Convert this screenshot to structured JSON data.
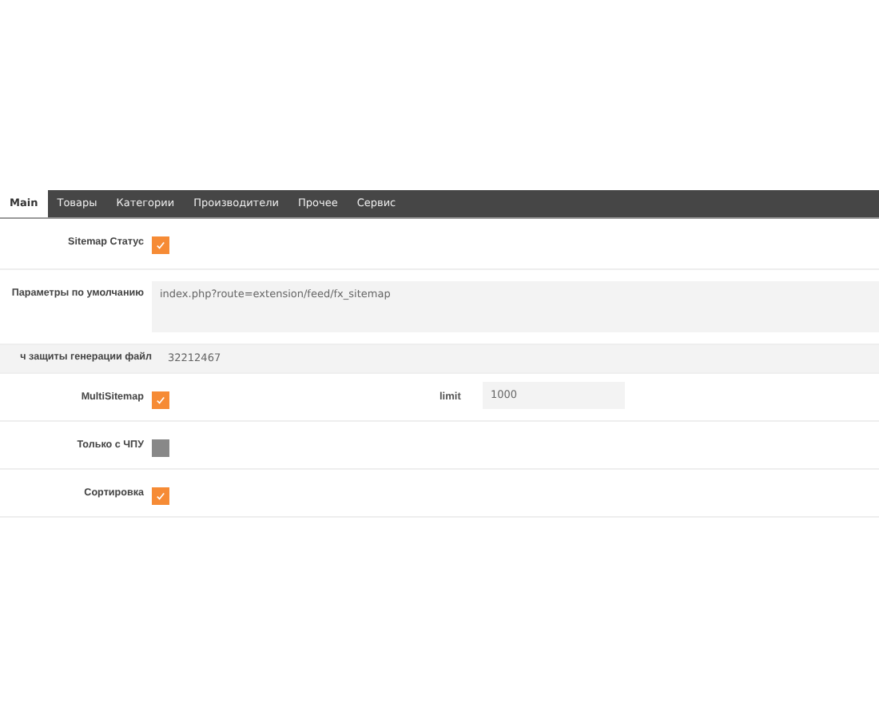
{
  "tabs": [
    {
      "label": "Main",
      "selected": true
    },
    {
      "label": "Товары",
      "selected": false
    },
    {
      "label": "Категории",
      "selected": false
    },
    {
      "label": "Производители",
      "selected": false
    },
    {
      "label": "Прочее",
      "selected": false
    },
    {
      "label": "Сервис",
      "selected": false
    }
  ],
  "rows": [
    {
      "kind": "checkbox",
      "label": "Sitemap Статус",
      "checked": true
    },
    {
      "kind": "textarea",
      "label": "Параметры по умолчанию",
      "value": "index.php?route=extension/feed/fx_sitemap"
    },
    {
      "kind": "input",
      "label": "ч защиты генерации файл",
      "value": "32212467"
    },
    {
      "kind": "checkbox",
      "label": "MultiSitemap",
      "checked": true,
      "extra": {
        "label": "limit",
        "value": "1000"
      }
    },
    {
      "kind": "checkbox",
      "label": "Только с ЧПУ",
      "checked": false
    },
    {
      "kind": "checkbox",
      "label": "Сортировка",
      "checked": true
    }
  ]
}
